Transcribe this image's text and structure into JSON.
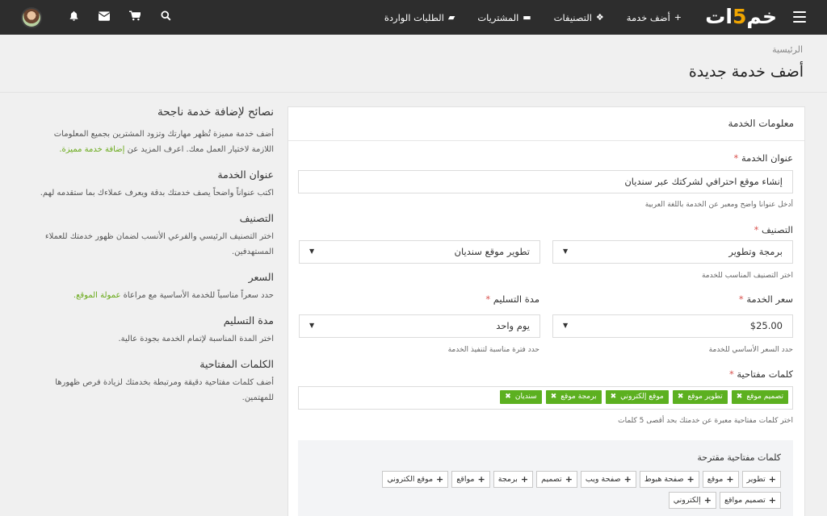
{
  "topbar": {
    "logo_main": "خمسات",
    "logo_digit": "5",
    "nav": [
      {
        "icon": "plus-icon",
        "glyph": "+",
        "label": "أضف خدمة"
      },
      {
        "icon": "cubes-icon",
        "glyph": "❖",
        "label": "التصنيفات"
      },
      {
        "icon": "folder-icon",
        "glyph": "▬",
        "label": "المشتريات"
      },
      {
        "icon": "truck-icon",
        "glyph": "▰",
        "label": "الطلبات الواردة"
      }
    ],
    "icons": [
      "search-icon",
      "cart-icon",
      "mail-icon",
      "bell-icon"
    ]
  },
  "header": {
    "breadcrumb": "الرئيسية",
    "title": "أضف خدمة جديدة"
  },
  "tips": {
    "title": "نصائح لإضافة خدمة ناجحة",
    "intro": "أضف خدمة مميزة تُظهر مهارتك وتزود المشترين بجميع المعلومات اللازمة لاختيار العمل معك. اعرف المزيد عن",
    "intro_link": "إضافة خدمة مميزة.",
    "items": [
      {
        "heading": "عنوان الخدمة",
        "text": "اكتب عنواناً واضحاً يصف خدمتك بدقة ويعرف عملاءك بما ستقدمه لهم."
      },
      {
        "heading": "التصنيف",
        "text": "اختر التصنيف الرئيسي والفرعي الأنسب لضمان ظهور خدمتك للعملاء المستهدفين."
      },
      {
        "heading": "السعر",
        "text": "حدد سعراً مناسباً للخدمة الأساسية مع مراعاة",
        "link": "عمولة الموقع."
      },
      {
        "heading": "مدة التسليم",
        "text": "اختر المدة المناسبة لإتمام الخدمة بجودة عالية."
      },
      {
        "heading": "الكلمات المفتاحية",
        "text": "أضف كلمات مفتاحية دقيقة ومرتبطة بخدمتك لزيادة فرص ظهورها للمهتمين."
      }
    ]
  },
  "form": {
    "panel_title": "معلومات الخدمة",
    "title_label": "عنوان الخدمة",
    "title_value": "إنشاء موقع احترافي لشركتك عبر سنديان",
    "title_hint": "أدخل عنوانا واضح ومعبر عن الخدمة باللغة العربية",
    "category_label": "التصنيف",
    "category_main": "برمجة وتطوير",
    "category_sub": "تطوير موقع سنديان",
    "category_hint": "اختر التصنيف المناسب للخدمة",
    "price_label": "سعر الخدمة",
    "price_value": "$25.00",
    "price_hint": "حدد السعر الأساسي للخدمة",
    "delivery_label": "مدة التسليم",
    "delivery_value": "يوم واحد",
    "delivery_hint": "حدد فترة مناسبة لتنفيذ الخدمة",
    "keywords_label": "كلمات مفتاحية",
    "required_mark": "*",
    "keywords": [
      "تصميم موقع",
      "تطوير موقع",
      "موقع إلكتروني",
      "برمجة موقع",
      "سنديان"
    ],
    "keywords_hint": "اختر كلمات مفتاحية معبرة عن خدمتك بحد أقصى 5 كلمات",
    "suggest_title": "كلمات مفتاحية مقترحة",
    "suggestions": [
      "تطوير",
      "موقع",
      "صفحة هبوط",
      "صفحة ويب",
      "تصميم",
      "برمجة",
      "مواقع",
      "موقع الكتروني",
      "تصميم مواقع",
      "إلكتروني"
    ]
  },
  "colors": {
    "topbar": "#2d2d2d",
    "accent_green": "#5cb020",
    "logo_accent": "#f0a500",
    "required": "#d9534f"
  }
}
